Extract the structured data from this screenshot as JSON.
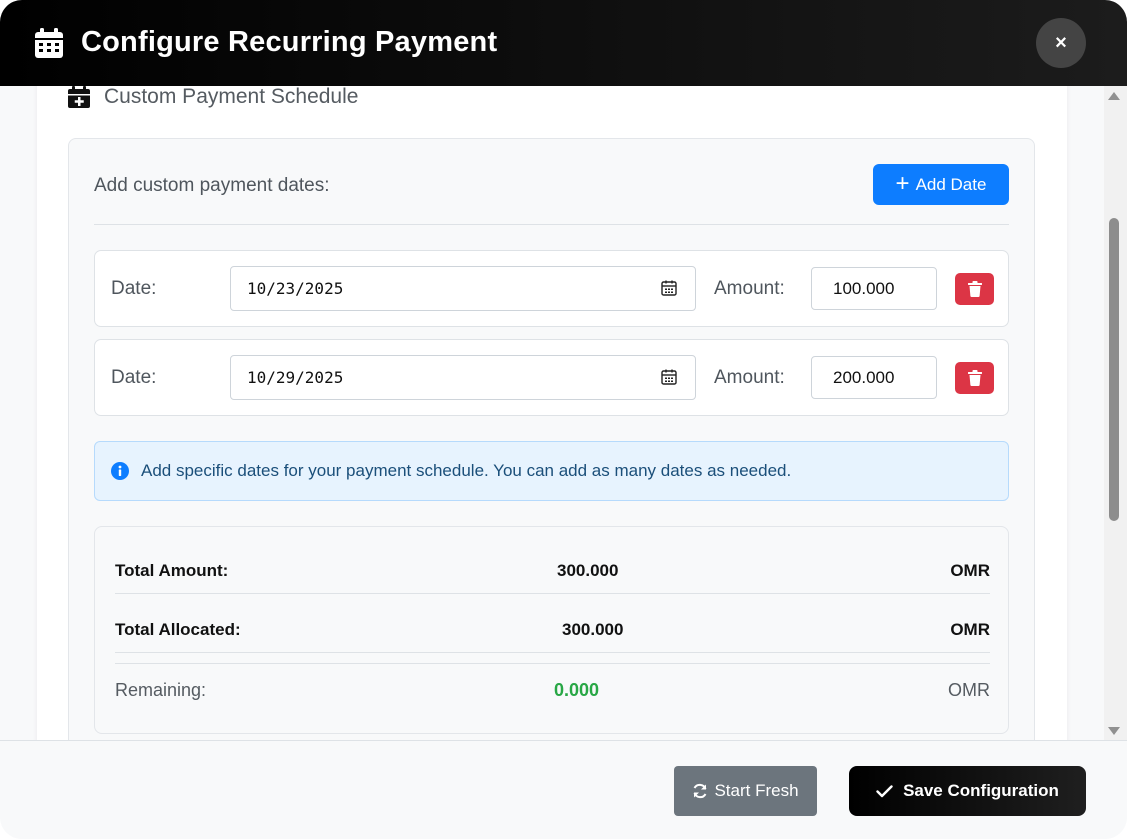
{
  "header": {
    "title": "Configure Recurring Payment",
    "icon": "calendar-icon",
    "close_label": "×"
  },
  "section": {
    "title": "Custom Payment Schedule",
    "icon": "calendar-plus-icon"
  },
  "schedule": {
    "heading": "Add custom payment dates:",
    "add_button": "Add Date",
    "date_label": "Date:",
    "amount_label": "Amount:",
    "rows": [
      {
        "date": "10/23/2025",
        "amount": "100.000"
      },
      {
        "date": "10/29/2025",
        "amount": "200.000"
      }
    ]
  },
  "info": {
    "text": "Add specific dates for your payment schedule. You can add as many dates as needed."
  },
  "summary": {
    "total_amount_label": "Total Amount:",
    "total_amount_value": "300.000",
    "total_allocated_label": "Total Allocated:",
    "total_allocated_value": "300.000",
    "remaining_label": "Remaining:",
    "remaining_value": "0.000",
    "currency": "OMR"
  },
  "footer": {
    "start_fresh": "Start Fresh",
    "save": "Save Configuration"
  },
  "colors": {
    "primary": "#0d7dff",
    "danger": "#dc3545",
    "success": "#28a745",
    "secondary": "#6c757d",
    "header": "#000000"
  }
}
